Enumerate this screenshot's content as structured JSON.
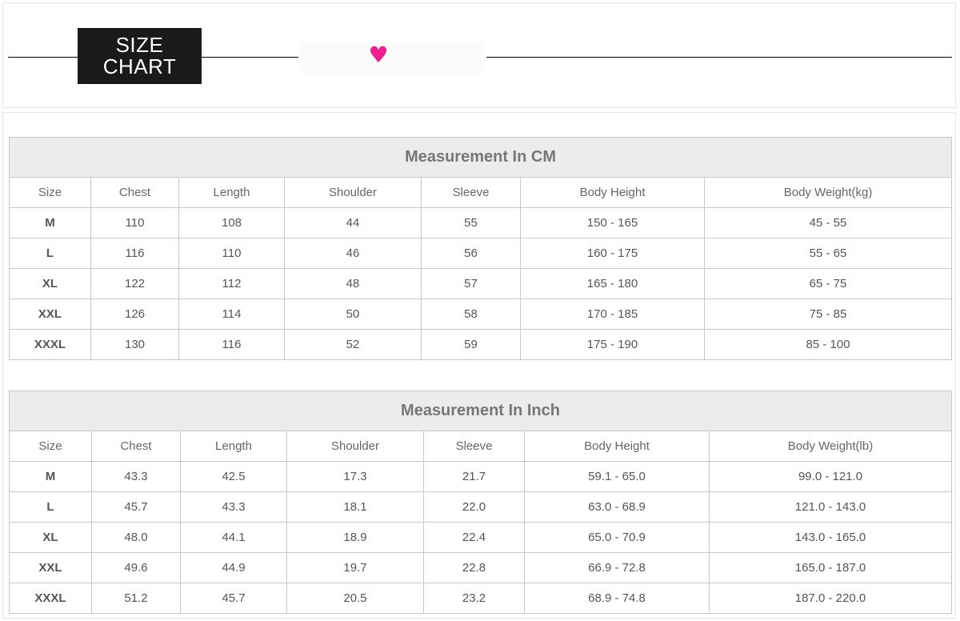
{
  "header": {
    "badge_line1": "SIZE",
    "badge_line2": "CHART",
    "heart_icon": "heart-icon",
    "heart_color": "#ee1f8f"
  },
  "tables": [
    {
      "title": "Measurement In CM",
      "columns": [
        "Size",
        "Chest",
        "Length",
        "Shoulder",
        "Sleeve",
        "Body Height",
        "Body Weight(kg)"
      ],
      "rows": [
        [
          "M",
          "110",
          "108",
          "44",
          "55",
          "150 - 165",
          "45 - 55"
        ],
        [
          "L",
          "116",
          "110",
          "46",
          "56",
          "160 - 175",
          "55 - 65"
        ],
        [
          "XL",
          "122",
          "112",
          "48",
          "57",
          "165 - 180",
          "65 - 75"
        ],
        [
          "XXL",
          "126",
          "114",
          "50",
          "58",
          "170 - 185",
          "75 - 85"
        ],
        [
          "XXXL",
          "130",
          "116",
          "52",
          "59",
          "175 - 190",
          "85 - 100"
        ]
      ]
    },
    {
      "title": "Measurement In Inch",
      "columns": [
        "Size",
        "Chest",
        "Length",
        "Shoulder",
        "Sleeve",
        "Body Height",
        "Body Weight(lb)"
      ],
      "rows": [
        [
          "M",
          "43.3",
          "42.5",
          "17.3",
          "21.7",
          "59.1 - 65.0",
          "99.0 - 121.0"
        ],
        [
          "L",
          "45.7",
          "43.3",
          "18.1",
          "22.0",
          "63.0 - 68.9",
          "121.0 - 143.0"
        ],
        [
          "XL",
          "48.0",
          "44.1",
          "18.9",
          "22.4",
          "65.0 - 70.9",
          "143.0 - 165.0"
        ],
        [
          "XXL",
          "49.6",
          "44.9",
          "19.7",
          "22.8",
          "66.9 - 72.8",
          "165.0 - 187.0"
        ],
        [
          "XXXL",
          "51.2",
          "45.7",
          "20.5",
          "23.2",
          "68.9 - 74.8",
          "187.0 - 220.0"
        ]
      ]
    }
  ]
}
